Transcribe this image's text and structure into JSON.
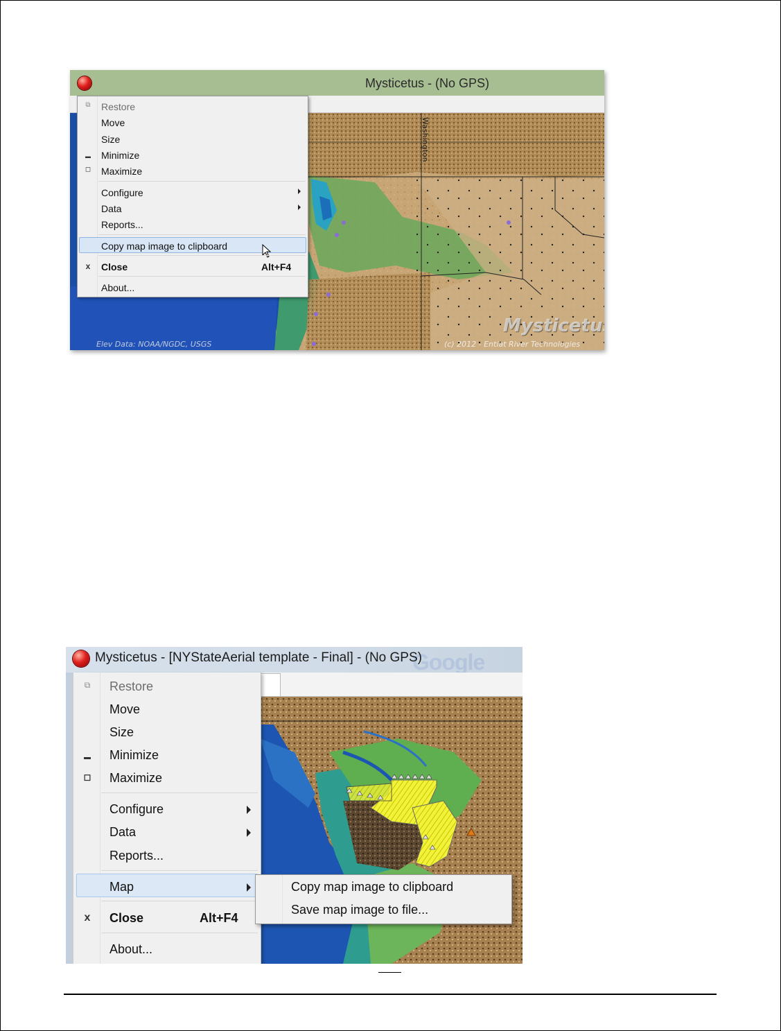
{
  "screenshot1": {
    "window_title": "Mysticetus - (No GPS)",
    "map_watermark": "Mysticetus",
    "map_credit_left": "Elev Data: NOAA/NGDC, USGS",
    "map_credit_right": "(c) 2012 - Entiat River Technologies",
    "map_vertical_label": "Washington",
    "system_menu": [
      {
        "label": "Restore",
        "icon": "restore-icon",
        "disabled": true
      },
      {
        "label": "Move"
      },
      {
        "label": "Size"
      },
      {
        "label": "Minimize",
        "icon": "minimize-icon"
      },
      {
        "label": "Maximize",
        "icon": "maximize-icon"
      },
      {
        "label": "Configure",
        "submenu": true
      },
      {
        "label": "Data",
        "submenu": true
      },
      {
        "label": "Reports..."
      },
      {
        "label": "Copy map image to clipboard",
        "highlighted": true
      },
      {
        "label": "Close",
        "accelerator": "Alt+F4",
        "icon": "close-icon",
        "bold": true
      },
      {
        "label": "About..."
      }
    ]
  },
  "screenshot2": {
    "window_title": "Mysticetus - [NYStateAerial template - Final] - (No GPS)",
    "background_ghost_text": "Google",
    "system_menu": [
      {
        "label": "Restore",
        "icon": "restore-icon",
        "disabled": true
      },
      {
        "label": "Move"
      },
      {
        "label": "Size"
      },
      {
        "label": "Minimize",
        "icon": "minimize-icon"
      },
      {
        "label": "Maximize",
        "icon": "maximize-icon"
      },
      {
        "label": "Configure",
        "submenu": true
      },
      {
        "label": "Data",
        "submenu": true
      },
      {
        "label": "Reports..."
      },
      {
        "label": "Map",
        "submenu": true,
        "highlighted": true
      },
      {
        "label": "Close",
        "accelerator": "Alt+F4",
        "icon": "close-icon",
        "bold": true
      },
      {
        "label": "About..."
      }
    ],
    "map_submenu": [
      {
        "label": "Copy map image to clipboard"
      },
      {
        "label": "Save map image to file..."
      }
    ]
  },
  "icons": {
    "restore": "⧉",
    "minimize": "▬",
    "maximize": "◻",
    "close": "x"
  },
  "colors": {
    "titlebar_green": "#a7be93",
    "titlebar_blue": "#d0dbe7",
    "menu_bg": "#f0f0f0",
    "highlight": "#d8e6f6"
  }
}
